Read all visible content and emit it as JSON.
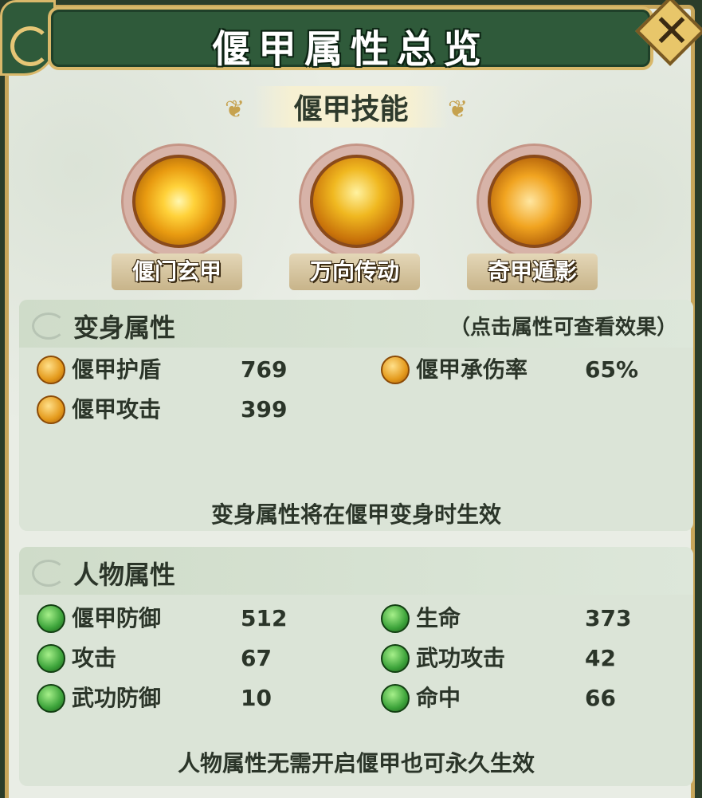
{
  "window": {
    "title": "偃甲属性总览",
    "close_icon": "close-icon"
  },
  "skills": {
    "header": "偃甲技能",
    "items": [
      {
        "label": "偃门玄甲",
        "icon": "golden-shield-burst-icon"
      },
      {
        "label": "万向传动",
        "icon": "mech-gear-figure-icon"
      },
      {
        "label": "奇甲遁影",
        "icon": "speed-boot-icon"
      }
    ]
  },
  "transform_panel": {
    "title": "变身属性",
    "hint": "（点击属性可查看效果）",
    "stats": [
      {
        "name": "偃甲护盾",
        "value": "769",
        "icon": "gold-coin-icon"
      },
      {
        "name": "偃甲攻击",
        "value": "399",
        "icon": "gold-coin-icon"
      },
      {
        "name": "偃甲承伤率",
        "value": "65%",
        "icon": "gold-coin-icon"
      }
    ],
    "note": "变身属性将在偃甲变身时生效"
  },
  "character_panel": {
    "title": "人物属性",
    "stats": [
      {
        "name": "偃甲防御",
        "value": "512",
        "icon": "green-orb-icon"
      },
      {
        "name": "攻击",
        "value": "67",
        "icon": "green-orb-icon"
      },
      {
        "name": "武功防御",
        "value": "10",
        "icon": "green-orb-icon"
      },
      {
        "name": "生命",
        "value": "373",
        "icon": "green-orb-icon"
      },
      {
        "name": "武功攻击",
        "value": "42",
        "icon": "green-orb-icon"
      },
      {
        "name": "命中",
        "value": "66",
        "icon": "green-orb-icon"
      }
    ],
    "note": "人物属性无需开启偃甲也可永久生效"
  },
  "colors": {
    "title_plate": "#2f5a3a",
    "gold_border": "#d9b86a",
    "panel_bg": "#dbe4d7",
    "text_dark": "#2b3529"
  }
}
